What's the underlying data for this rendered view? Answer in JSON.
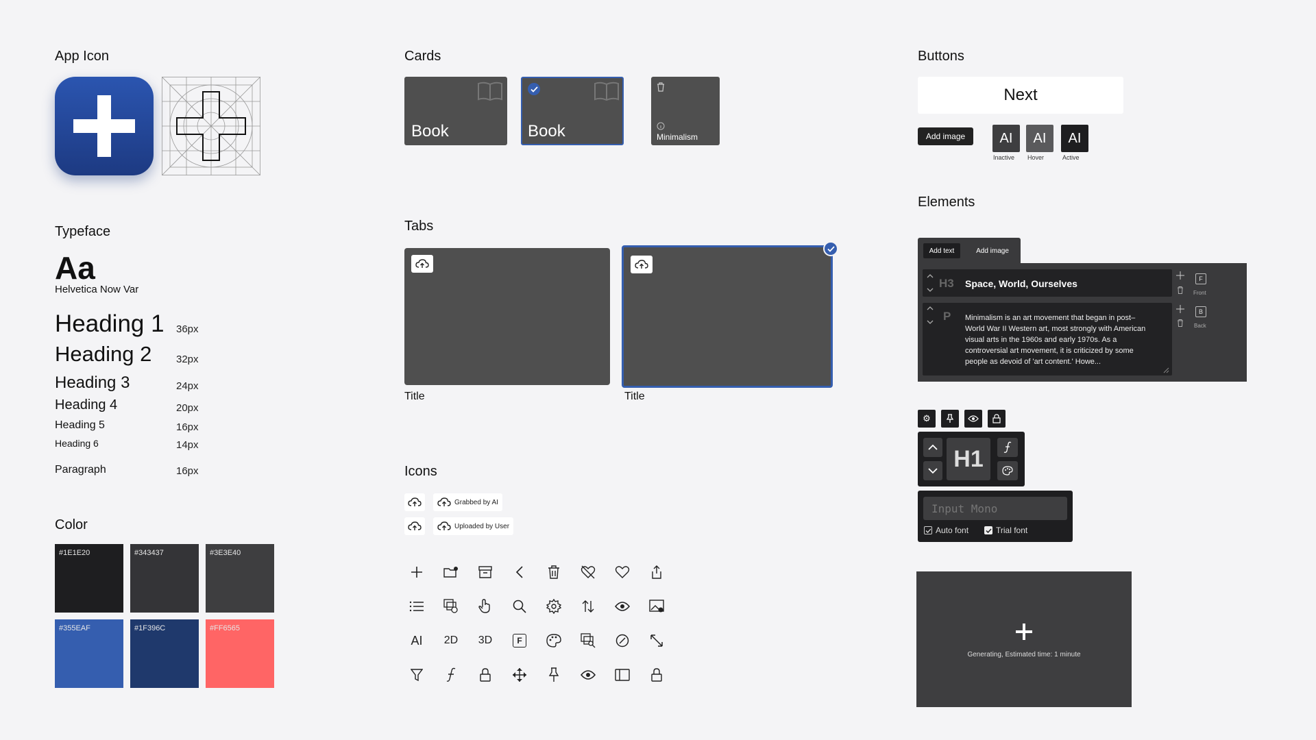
{
  "app_icon": {
    "title": "App Icon"
  },
  "typeface": {
    "title": "Typeface",
    "sample": "Aa",
    "font_name": "Helvetica Now Var",
    "rows": [
      {
        "label": "Heading 1",
        "size": "36px"
      },
      {
        "label": "Heading 2",
        "size": "32px"
      },
      {
        "label": "Heading 3",
        "size": "24px"
      },
      {
        "label": "Heading 4",
        "size": "20px"
      },
      {
        "label": "Heading 5",
        "size": "16px"
      },
      {
        "label": "Heading 6",
        "size": "14px"
      },
      {
        "label": "Paragraph",
        "size": "16px"
      }
    ]
  },
  "color": {
    "title": "Color",
    "swatches": [
      {
        "hex": "#1E1E20",
        "color": "#1E1E20"
      },
      {
        "hex": "#343437",
        "color": "#343437"
      },
      {
        "hex": "#3E3E40",
        "color": "#3E3E40"
      },
      {
        "hex": "#355EAF",
        "color": "#355EAF"
      },
      {
        "hex": "#1F396C",
        "color": "#1F396C"
      },
      {
        "hex": "#FF6565",
        "color": "#FF6565"
      }
    ]
  },
  "cards": {
    "title": "Cards",
    "card1_label": "Book",
    "card2_label": "Book",
    "card3_label": "Minimalism"
  },
  "tabs": {
    "title": "Tabs",
    "tab1_title": "Title",
    "tab2_title": "Title"
  },
  "icons": {
    "title": "Icons",
    "chip_grabbed": "Grabbed by AI",
    "chip_uploaded": "Uploaded by User",
    "text_icons": {
      "ai": "AI",
      "2d": "2D",
      "3d": "3D",
      "f": "F"
    }
  },
  "buttons": {
    "title": "Buttons",
    "next": "Next",
    "add_image": "Add image",
    "ai_glyph": "AI",
    "states": [
      "Inactive",
      "Hover",
      "Active"
    ]
  },
  "elements": {
    "title": "Elements",
    "tab_add_text": "Add text",
    "tab_add_image": "Add image",
    "h3_tag": "H3",
    "h3_text": "Space, World, Ourselves",
    "p_tag": "P",
    "p_text": "Minimalism is an art movement that began in post–World War II Western art, most strongly with American visual arts in the 1960s and early 1970s. As a controversial art movement, it is criticized by some people as devoid of 'art content.' Howe...",
    "front_label": "Front",
    "back_label": "Back",
    "h1_tag": "H1",
    "input_placeholder": "Input Mono",
    "auto_font": "Auto font",
    "trial_font": "Trial font",
    "generating": "Generating, Estimated time: 1 minute"
  },
  "colors": {
    "accent": "#355EAF",
    "dark": "#3E3E40"
  }
}
